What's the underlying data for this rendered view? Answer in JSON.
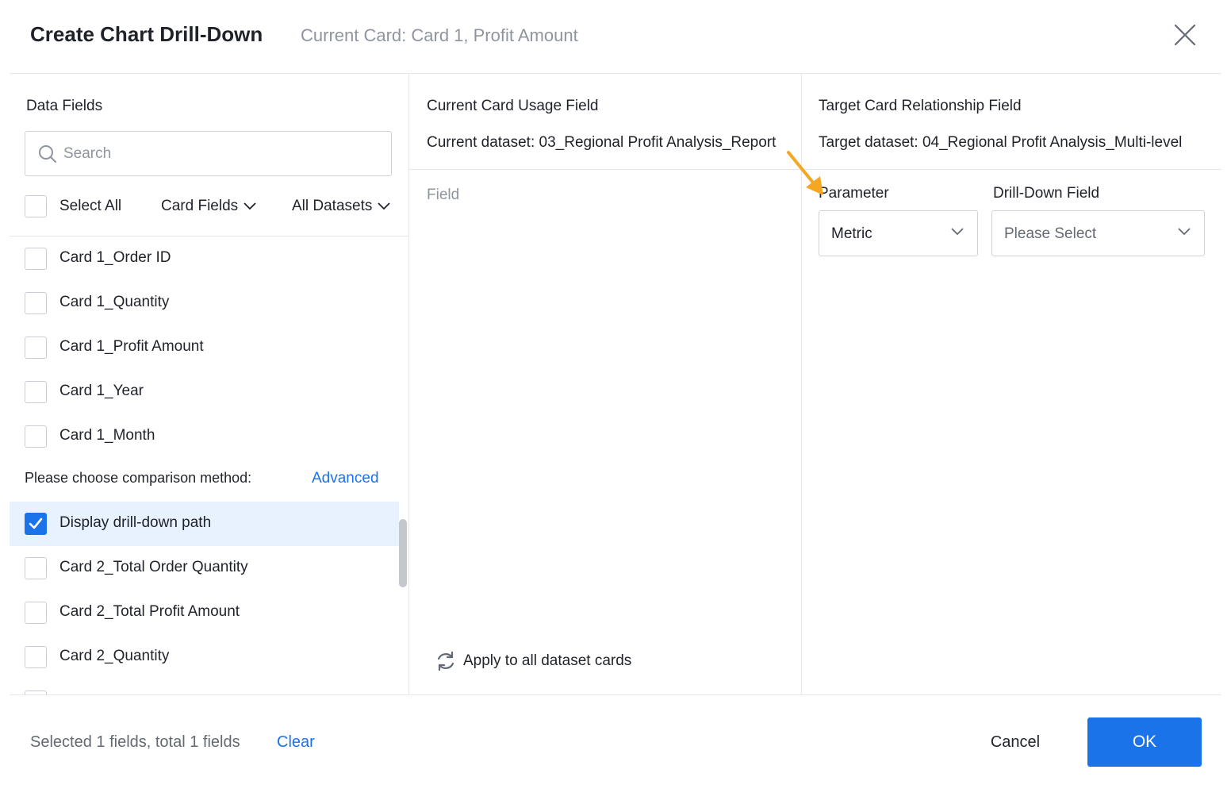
{
  "dialog": {
    "title": "Create Chart Drill-Down",
    "subtitle": "Current Card: Card 1, Profit Amount"
  },
  "left": {
    "title": "Data Fields",
    "search_placeholder": "Search",
    "select_all": "Select All",
    "card_fields": "Card Fields",
    "all_datasets": "All Datasets",
    "fields_group1": [
      {
        "label": "Card 1_Order ID",
        "checked": false
      },
      {
        "label": "Card 1_Quantity",
        "checked": false
      },
      {
        "label": "Card 1_Profit Amount",
        "checked": false
      },
      {
        "label": "Card 1_Year",
        "checked": false
      },
      {
        "label": "Card 1_Month",
        "checked": false
      }
    ],
    "comparison_label": "Please choose comparison method:",
    "advanced_link": "Advanced",
    "fields_group2": [
      {
        "label": "Display drill-down path",
        "checked": true
      },
      {
        "label": "Card 2_Total Order Quantity",
        "checked": false
      },
      {
        "label": "Card 2_Total Profit Amount",
        "checked": false
      },
      {
        "label": "Card 2_Quantity",
        "checked": false
      }
    ]
  },
  "middle": {
    "title": "Current Card Usage Field",
    "dataset": "Current dataset: 03_Regional Profit Analysis_Report",
    "field_header": "Field",
    "apply_all": "Apply to all dataset cards"
  },
  "right": {
    "title": "Target Card Relationship Field",
    "dataset": "Target dataset: 04_Regional Profit Analysis_Multi-level",
    "parameter_label": "Parameter",
    "drilldown_label": "Drill-Down Field",
    "parameter_value": "Metric",
    "drilldown_placeholder": "Please Select"
  },
  "footer": {
    "status": "Selected 1 fields, total 1 fields",
    "clear": "Clear",
    "cancel": "Cancel",
    "ok": "OK"
  },
  "colors": {
    "accent": "#1a73e8",
    "highlight_row": "#e8f2fe",
    "annotation_arrow": "#f5a623"
  },
  "icons": {
    "close": "close-icon",
    "search": "search-icon",
    "chevron": "chevron-down-icon",
    "refresh": "refresh-icon",
    "check": "check-icon",
    "arrow": "annotation-arrow-icon"
  }
}
